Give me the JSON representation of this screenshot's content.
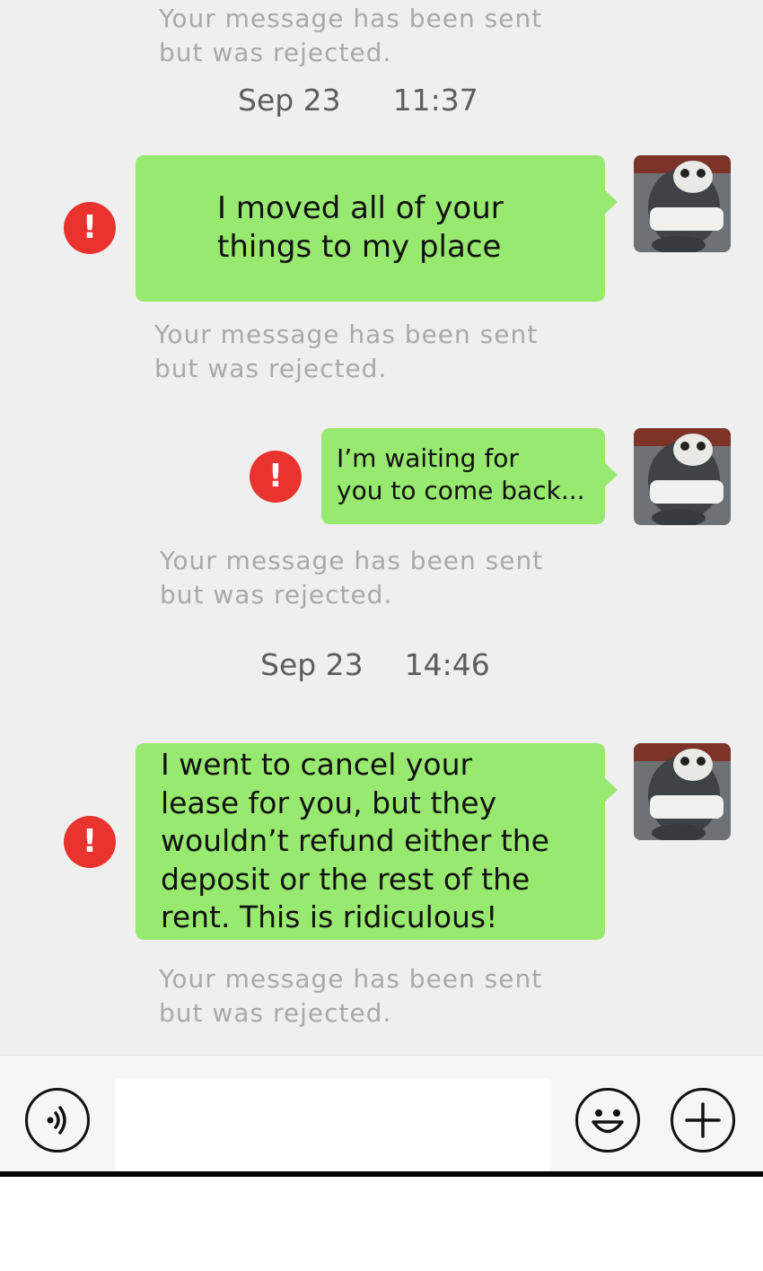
{
  "colors": {
    "chat_background": "#efefef",
    "bubble_green": "#98e96f",
    "error_red": "#e8332f",
    "notice_gray": "#a9a9a9",
    "timestamp_gray": "#5d5d5d"
  },
  "notices": [
    {
      "line1": "Your message has been sent",
      "line2": "but was rejected."
    },
    {
      "line1": "Your message has been sent",
      "line2": "but was rejected."
    },
    {
      "line1": "Your message has been sent",
      "line2": "but was rejected."
    },
    {
      "line1": "Your message has been sent",
      "line2": "but was rejected."
    }
  ],
  "timestamps": [
    {
      "date": "Sep 23",
      "time": "11:37"
    },
    {
      "date": "Sep 23",
      "time": "14:46"
    }
  ],
  "messages": [
    {
      "lines": [
        "I moved all of your",
        "things to my place"
      ],
      "status": "failed",
      "status_icon": "!"
    },
    {
      "lines": [
        "I’m waiting for",
        "you to come back..."
      ],
      "status": "failed",
      "status_icon": "!"
    },
    {
      "lines": [
        "I went to cancel your",
        "lease for you, but they",
        "wouldn’t refund either the",
        "deposit or the rest of the",
        "rent. This is ridiculous!"
      ],
      "status": "failed",
      "status_icon": "!"
    }
  ],
  "avatar": {
    "icon": "panda-plush-avatar"
  },
  "input_bar": {
    "voice_icon": "voice-icon",
    "message_value": "",
    "emoji_icon": "emoji-icon",
    "add_icon": "plus-icon"
  }
}
